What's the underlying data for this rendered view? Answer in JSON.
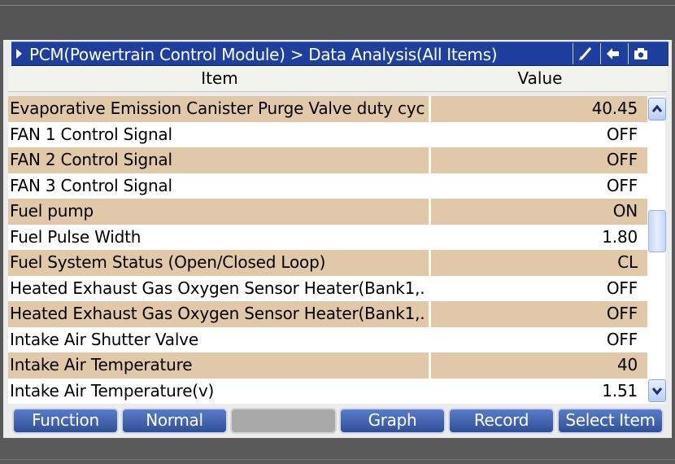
{
  "title": "PCM(Powertrain Control Module) > Data Analysis(All Items)",
  "toolbar_icons": [
    "brush-icon",
    "back-arrow-icon",
    "camera-icon"
  ],
  "columns": {
    "item": "Item",
    "value": "Value"
  },
  "rows": [
    {
      "name": "Evaporative Emission Canister Purge Valve duty cycle",
      "value": "40.45"
    },
    {
      "name": "FAN 1 Control Signal",
      "value": "OFF"
    },
    {
      "name": "FAN 2 Control Signal",
      "value": "OFF"
    },
    {
      "name": "FAN 3 Control Signal",
      "value": "OFF"
    },
    {
      "name": "Fuel pump",
      "value": "ON"
    },
    {
      "name": "Fuel Pulse Width",
      "value": "1.80"
    },
    {
      "name": "Fuel System Status (Open/Closed Loop)",
      "value": "CL"
    },
    {
      "name": "Heated Exhaust Gas Oxygen Sensor Heater(Bank1,...",
      "value": "OFF"
    },
    {
      "name": "Heated Exhaust Gas Oxygen Sensor Heater(Bank1,...",
      "value": "OFF"
    },
    {
      "name": "Intake Air Shutter Valve",
      "value": "OFF"
    },
    {
      "name": "Intake Air Temperature",
      "value": "40"
    },
    {
      "name": "Intake Air Temperature(v)",
      "value": "1.51"
    }
  ],
  "buttons": {
    "function": "Function",
    "normal": "Normal",
    "blank": "",
    "graph": "Graph",
    "record": "Record",
    "select_item": "Select Item"
  },
  "colors": {
    "title_bar": "#1f3f9e",
    "row_shaded": "#e0c8a8",
    "row_plain": "#ffffff",
    "button": "#3f5fab"
  }
}
